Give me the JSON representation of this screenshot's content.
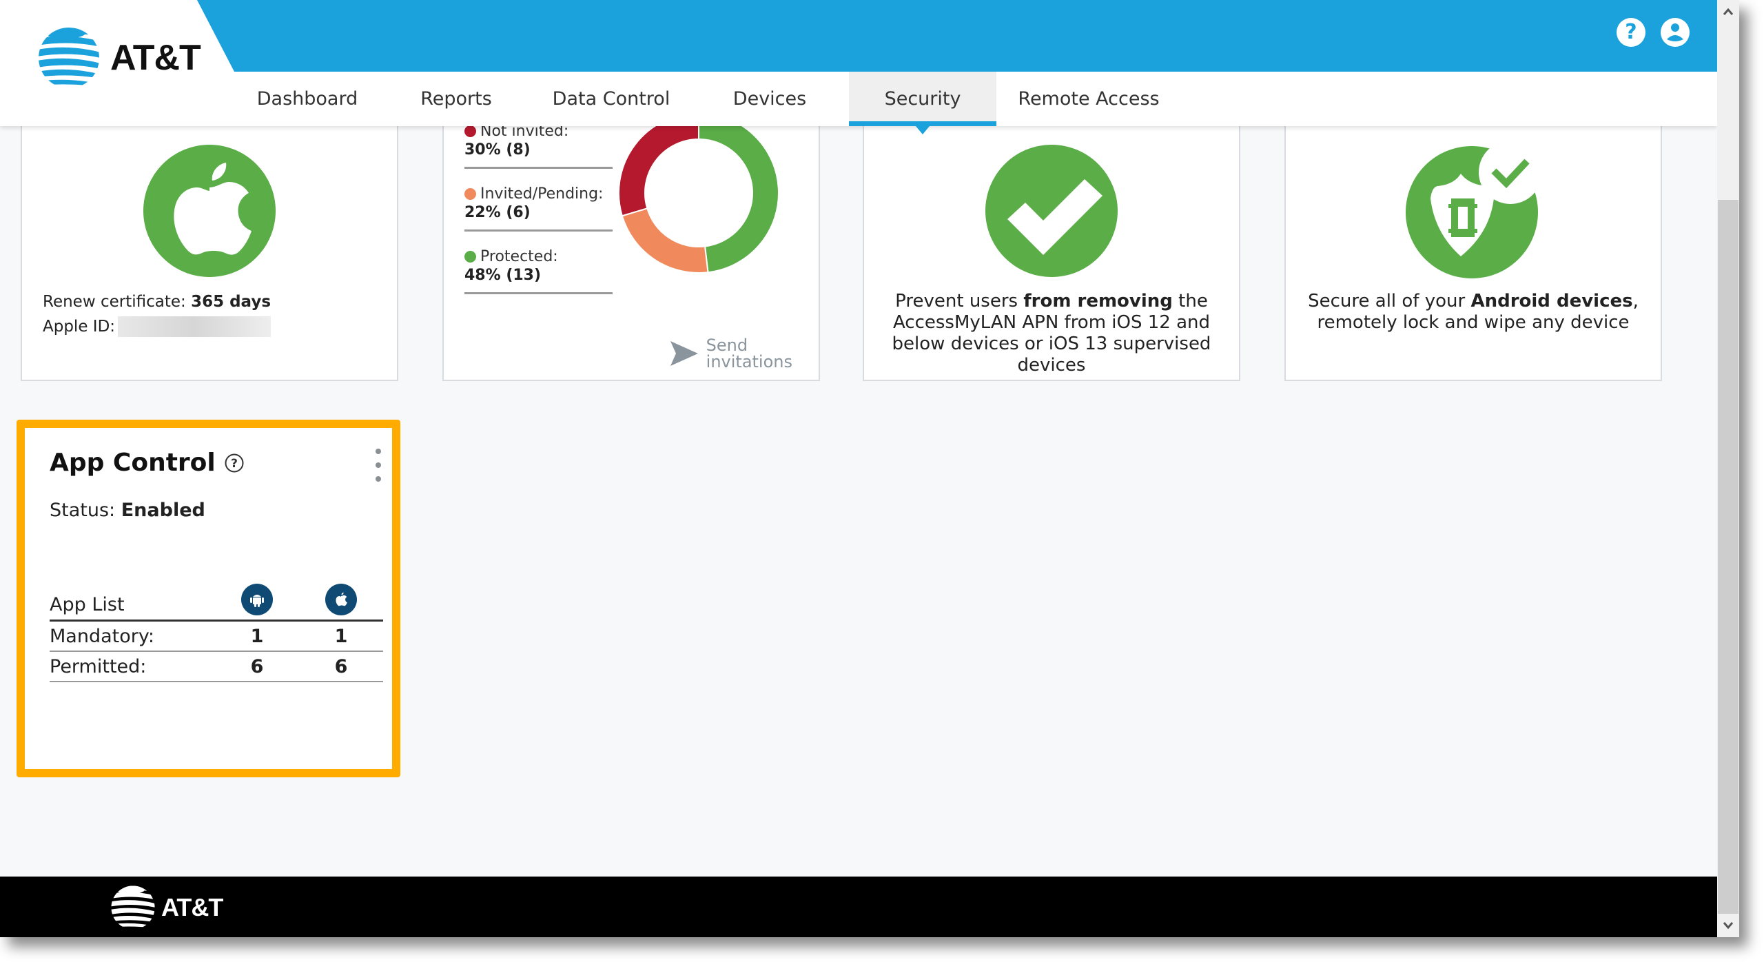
{
  "brand": {
    "name": "AT&T",
    "accent": "#1ba1db",
    "success_green": "#5aad47",
    "highlight_orange": "#ffab00"
  },
  "header": {
    "icons": [
      {
        "name": "help-icon",
        "label": "?"
      },
      {
        "name": "user-account-icon",
        "label": ""
      }
    ]
  },
  "nav": {
    "tabs": [
      {
        "label": "Dashboard",
        "active": false
      },
      {
        "label": "Reports",
        "active": false
      },
      {
        "label": "Data Control",
        "active": false
      },
      {
        "label": "Devices",
        "active": false
      },
      {
        "label": "Security",
        "active": true
      },
      {
        "label": "Remote Access",
        "active": false
      }
    ]
  },
  "cards": {
    "apple_cert": {
      "icon": "apple-icon",
      "renew_label": "Renew certificate:",
      "renew_value": "365 days",
      "apple_id_label": "Apple ID:",
      "apple_id_value": ""
    },
    "invitations": {
      "legend": [
        {
          "label": "Not invited:",
          "value": "30% (8)",
          "color": "#b5192e"
        },
        {
          "label": "Invited/Pending:",
          "value": "22% (6)",
          "color": "#f08a5d"
        },
        {
          "label": "Protected:",
          "value": "48% (13)",
          "color": "#5aad47"
        }
      ],
      "send_line1": "Send",
      "send_line2": "invitations"
    },
    "apn": {
      "icon": "checkmark-icon",
      "text_pre": "Prevent users ",
      "text_bold": "from removing",
      "text_post": " the AccessMyLAN APN from iOS 12 and below devices or iOS 13 supervised devices"
    },
    "android": {
      "icon": "shield-check-icon",
      "text_pre": "Secure all of your ",
      "text_bold": "Android devices",
      "text_post": ", remotely lock and wipe any device"
    }
  },
  "app_control": {
    "title": "App Control",
    "status_label": "Status:",
    "status_value": "Enabled",
    "table": {
      "header": "App List",
      "columns": [
        "android",
        "apple"
      ],
      "rows": [
        {
          "label": "Mandatory:",
          "android": "1",
          "apple": "1"
        },
        {
          "label": "Permitted:",
          "android": "6",
          "apple": "6"
        }
      ]
    }
  },
  "footer": {
    "brand": "AT&T"
  },
  "chart_data": {
    "type": "pie",
    "title": "",
    "categories": [
      "Not invited",
      "Invited/Pending",
      "Protected"
    ],
    "values": [
      8,
      6,
      13
    ],
    "percentages": [
      30,
      22,
      48
    ],
    "colors": [
      "#b5192e",
      "#f08a5d",
      "#5aad47"
    ],
    "donut": true,
    "legend": "left"
  }
}
